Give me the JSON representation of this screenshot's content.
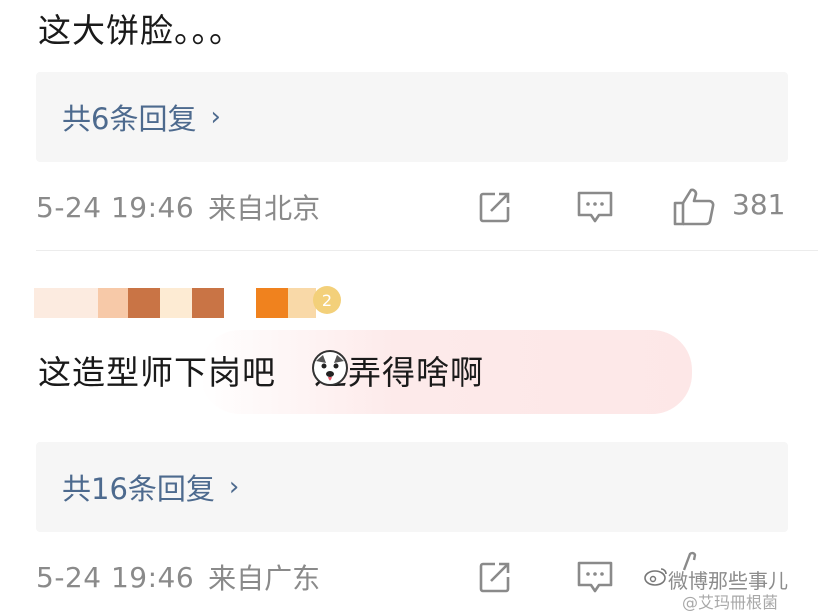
{
  "comment1": {
    "text": "这大饼脸。。。",
    "replies_label": "共6条回复",
    "chevron": "›",
    "time": "5-24 19:46",
    "location": "来自北京",
    "likes": "381"
  },
  "comment2": {
    "badge": "2",
    "text_before": "这造型师下岗吧",
    "emoji": "dog-face-emoji",
    "text_after": "这弄得啥啊",
    "replies_label": "共16条回复",
    "chevron": "›",
    "time": "5-24 19:46",
    "location": "来自广东"
  },
  "icons": {
    "share": "share-icon",
    "comment": "comment-icon",
    "like": "thumbs-up-icon",
    "weibo": "weibo-logo-icon"
  },
  "watermark": {
    "line1": "微博那些事儿",
    "line2": "@艾玛冊根菌"
  },
  "colors": {
    "link": "#4d6a8e",
    "meta": "#8a8a8a",
    "reply_bg": "#f6f6f6"
  }
}
